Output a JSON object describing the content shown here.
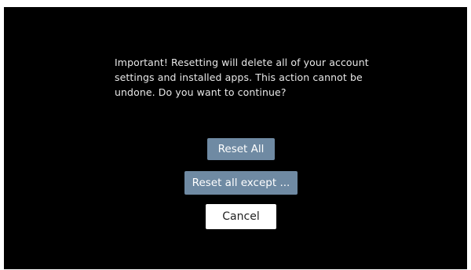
{
  "dialog": {
    "message": "Important! Resetting will delete all of your account settings and installed apps. This action cannot be undone. Do you want to continue?",
    "buttons": {
      "reset_all": "Reset All",
      "reset_except": "Reset all except ...",
      "cancel": "Cancel"
    },
    "focused_button": "cancel"
  },
  "colors": {
    "background": "#000000",
    "text": "#e8e8e8",
    "secondary_button": "#6f8aa3",
    "focused_button": "#ffffff"
  }
}
